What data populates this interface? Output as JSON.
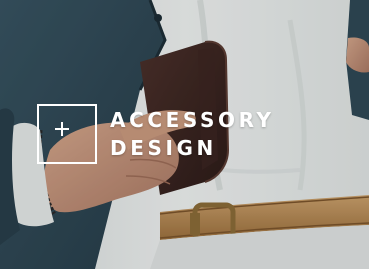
{
  "promo": {
    "title_line1": "ACCESSORY",
    "title_line2": "DESIGN"
  },
  "icons": {
    "badge": "plus-icon"
  },
  "colors": {
    "text": "#ffffff",
    "shirt": "#e7ebe9",
    "jacket": "#2f4a57",
    "wallet": "#3a2520",
    "belt": "#b8894d",
    "skin": "#c49478"
  }
}
